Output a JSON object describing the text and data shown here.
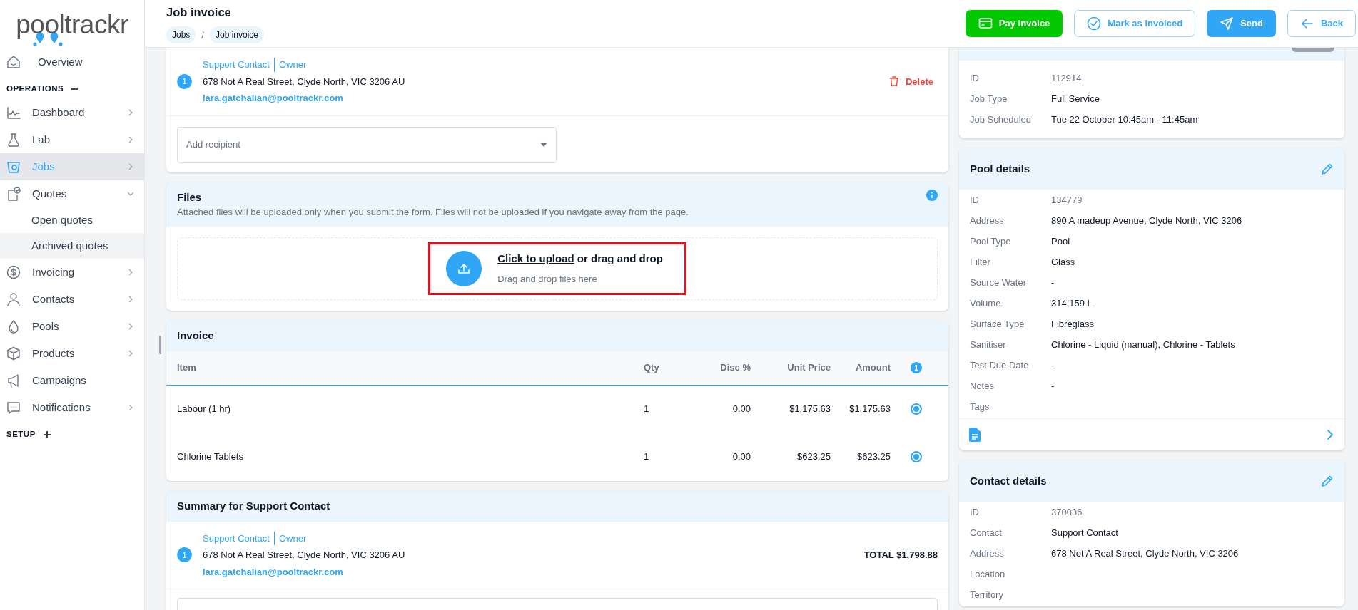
{
  "app_name": "pooltrackr",
  "sidebar": {
    "overview": {
      "label": "Overview",
      "selected": false
    },
    "sections": [
      {
        "title": "OPERATIONS",
        "expanded": true,
        "items": [
          {
            "label": "Dashboard",
            "selected": false,
            "hovered": false,
            "expanded": false
          },
          {
            "label": "Lab",
            "selected": false,
            "hovered": false,
            "expanded": false
          },
          {
            "label": "Jobs",
            "selected": true,
            "hovered": false,
            "expanded": false
          },
          {
            "label": "Quotes",
            "selected": false,
            "hovered": false,
            "expanded": true,
            "children": [
              {
                "label": "Open quotes",
                "selected": false,
                "hovered": false
              },
              {
                "label": "Archived quotes",
                "selected": false,
                "hovered": true
              }
            ]
          },
          {
            "label": "Invoicing",
            "selected": false,
            "hovered": false,
            "expanded": false
          },
          {
            "label": "Contacts",
            "selected": false,
            "hovered": false,
            "expanded": false
          },
          {
            "label": "Pools",
            "selected": false,
            "hovered": false,
            "expanded": false
          },
          {
            "label": "Products",
            "selected": false,
            "hovered": false,
            "expanded": false
          },
          {
            "label": "Campaigns",
            "selected": false,
            "hovered": false
          },
          {
            "label": "Notifications",
            "selected": false,
            "hovered": false,
            "expanded": false
          }
        ]
      },
      {
        "title": "SETUP",
        "expanded": false
      }
    ]
  },
  "header": {
    "title": "Job invoice",
    "breadcrumb_separator": "/",
    "breadcrumbs": [
      {
        "label": "Jobs"
      },
      {
        "label": "Job invoice"
      }
    ],
    "buttons": [
      {
        "label": "Pay invoice",
        "kind": "success"
      },
      {
        "label": "Mark as invoiced",
        "kind": "outline"
      },
      {
        "label": "Send",
        "kind": "primary"
      },
      {
        "label": "Back",
        "kind": "outline"
      }
    ]
  },
  "recipients": {
    "contact": {
      "number": "1",
      "name": "Support Contact",
      "role": "Owner",
      "address": "678 Not A Real Street, Clyde North, VIC 3206 AU",
      "email": "lara.gatchalian@pooltrackr.com"
    },
    "delete_label": "Delete",
    "add_placeholder": "Add recipient"
  },
  "files": {
    "title": "Files",
    "description": "Attached files will be uploaded only when you submit the form. Files will not be uploaded if you navigate away from the page.",
    "upload": {
      "link": "Click to upload",
      "rest": "or drag and drop",
      "hint": "Drag and drop files here",
      "highlighted": true
    }
  },
  "invoice": {
    "title": "Invoice",
    "columns": [
      "Item",
      "Qty",
      "Disc %",
      "Unit Price",
      "Amount"
    ],
    "count": "1",
    "rows": [
      {
        "item": "Labour (1 hr)",
        "qty": "1",
        "disc": "0.00",
        "unit_price": "$1,175.63",
        "amount": "$1,175.63",
        "selected": true
      },
      {
        "item": "Chlorine Tablets",
        "qty": "1",
        "disc": "0.00",
        "unit_price": "$623.25",
        "amount": "$623.25",
        "selected": true
      }
    ]
  },
  "summary": {
    "title": "Summary for Support Contact",
    "contact": {
      "number": "1",
      "name": "Support Contact",
      "role": "Owner",
      "address": "678 Not A Real Street, Clyde North, VIC 3206 AU",
      "email": "lara.gatchalian@pooltrackr.com"
    },
    "total": "TOTAL $1,798.88"
  },
  "job_details": {
    "rows": [
      {
        "label": "ID",
        "value": "112914"
      },
      {
        "label": "Job Type",
        "value": "Full Service"
      },
      {
        "label": "Job Scheduled",
        "value": "Tue 22 October 10:45am - 11:45am"
      }
    ]
  },
  "pool_details": {
    "title": "Pool details",
    "rows": [
      {
        "label": "ID",
        "value": "134779"
      },
      {
        "label": "Address",
        "value": "890 A madeup Avenue, Clyde North, VIC 3206"
      },
      {
        "label": "Pool Type",
        "value": "Pool"
      },
      {
        "label": "Filter",
        "value": "Glass"
      },
      {
        "label": "Source Water",
        "value": "-"
      },
      {
        "label": "Volume",
        "value": "314,159 L"
      },
      {
        "label": "Surface Type",
        "value": "Fibreglass"
      },
      {
        "label": "Sanitiser",
        "value": "Chlorine - Liquid (manual), Chlorine - Tablets"
      },
      {
        "label": "Test Due Date",
        "value": "-"
      },
      {
        "label": "Notes",
        "value": "-"
      },
      {
        "label": "Tags"
      }
    ]
  },
  "contact_details": {
    "title": "Contact details",
    "rows": [
      {
        "label": "ID",
        "value": "370036"
      },
      {
        "label": "Contact",
        "value": "Support Contact"
      },
      {
        "label": "Address",
        "value": "678 Not A Real Street, Clyde North, VIC 3206"
      },
      {
        "label": "Location"
      },
      {
        "label": "Territory"
      }
    ]
  }
}
